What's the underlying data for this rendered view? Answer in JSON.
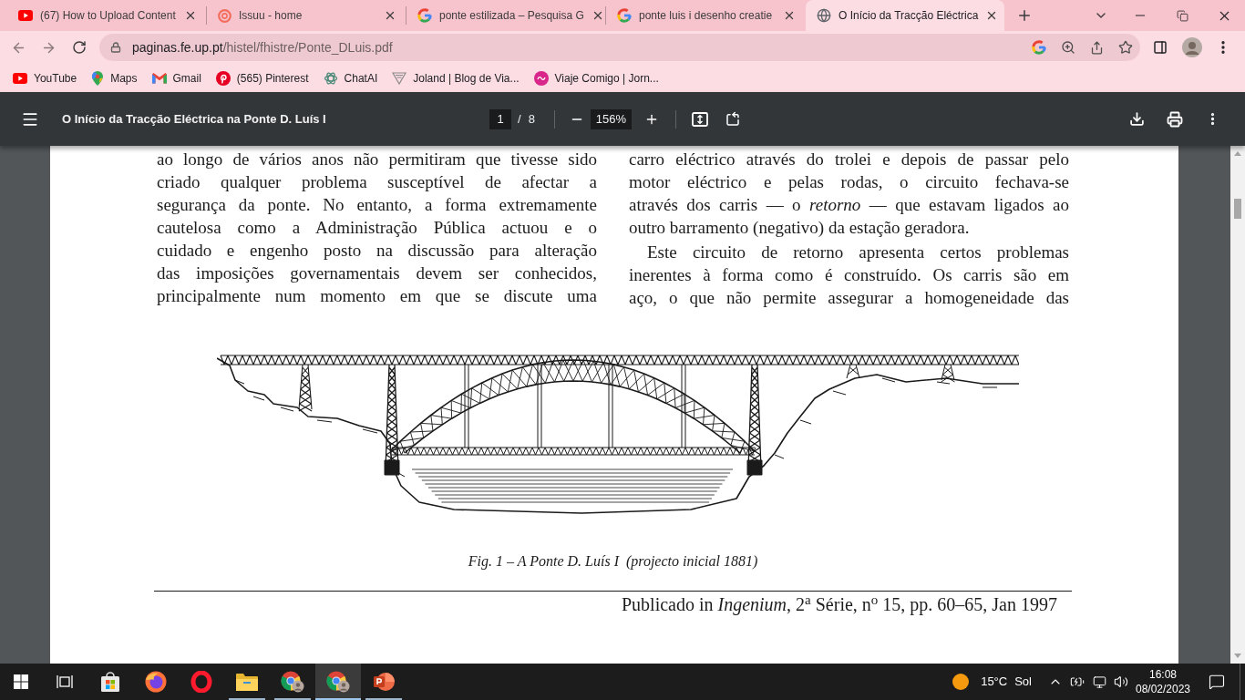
{
  "browser": {
    "tabs": [
      {
        "kind": "youtube",
        "title": "(67) How to Upload Content",
        "selected": false
      },
      {
        "kind": "issuu",
        "title": "Issuu - home",
        "selected": false
      },
      {
        "kind": "google",
        "title": "ponte estilizada – Pesquisa G",
        "selected": false
      },
      {
        "kind": "google",
        "title": "ponte luis i desenho creatie",
        "selected": false
      },
      {
        "kind": "globe",
        "title": "O Início da Tracção Eléctrica",
        "selected": true
      }
    ],
    "address_bar": {
      "host": "paginas.fe.up.pt",
      "path": "/histel/fhistre/Ponte_DLuis.pdf"
    },
    "bookmarks": [
      {
        "kind": "youtube",
        "label": "YouTube"
      },
      {
        "kind": "maps",
        "label": "Maps"
      },
      {
        "kind": "gmail",
        "label": "Gmail"
      },
      {
        "kind": "pinterest",
        "label": "(565) Pinterest"
      },
      {
        "kind": "chatai",
        "label": "ChatAI"
      },
      {
        "kind": "joland",
        "label": "Joland | Blog de Via..."
      },
      {
        "kind": "viaje",
        "label": "Viaje Comigo | Jorn..."
      }
    ]
  },
  "pdf_viewer": {
    "title": "O Início da Tracção Eléctrica na Ponte D. Luís I",
    "page": "1",
    "page_separator": "/",
    "page_count": "8",
    "zoom": "156%"
  },
  "document": {
    "columns": [
      {
        "paragraphs": [
          {
            "starts_here": false,
            "ends_here": false,
            "lines": [
              "ao longo de vários anos não permitiram que tivesse sido",
              "criado qualquer problema susceptível de afectar a",
              "segurança da ponte. No entanto, a forma extremamente",
              "cautelosa como a Administração Pública actuou e o",
              "cuidado e engenho posto na discussão para alteração",
              "das imposições governamentais devem ser conhecidos,",
              "principalmente num momento em que se discute uma"
            ]
          }
        ]
      },
      {
        "paragraphs": [
          {
            "starts_here": false,
            "ends_here": true,
            "lines": [
              "carro eléctrico através do trolei e depois de passar pelo",
              "motor eléctrico e pelas rodas, o circuito fechava-se",
              "através dos carris — o *retorno* — que estavam ligados ao",
              "outro barramento (negativo) da estação geradora."
            ]
          },
          {
            "starts_here": true,
            "ends_here": false,
            "lines": [
              "Este circuito de retorno apresenta certos problemas",
              "inerentes à forma como é construído. Os carris são em",
              "aço, o que não permite assegurar a homogeneidade das"
            ]
          }
        ]
      }
    ],
    "figure_caption": "Fig. 1 – A Ponte D. Luís I  (projecto inicial 1881)",
    "publication": "Publicado in *Ingenium*, 2$^{a}$ Série, n$^{o}$ 15, pp. 60–65, Jan 1997"
  },
  "taskbar": {
    "apps": [
      {
        "kind": "store",
        "running": false,
        "selected": false
      },
      {
        "kind": "firefox",
        "running": false,
        "selected": false
      },
      {
        "kind": "opera",
        "running": false,
        "selected": false
      },
      {
        "kind": "explorer",
        "running": true,
        "selected": false
      },
      {
        "kind": "chrome",
        "running": true,
        "selected": false
      },
      {
        "kind": "chrome",
        "running": true,
        "selected": true
      },
      {
        "kind": "powerpoint",
        "running": true,
        "selected": false
      }
    ],
    "weather": {
      "temperature": "15°C",
      "condition": "Sol"
    },
    "clock": {
      "time": "16:08",
      "date": "08/02/2023"
    }
  }
}
